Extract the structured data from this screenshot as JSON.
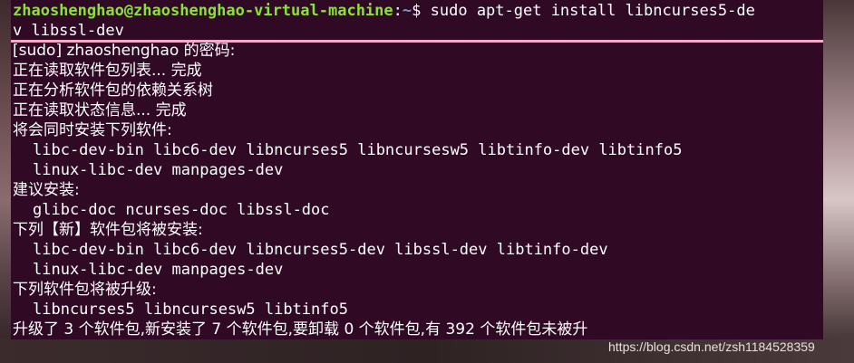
{
  "terminal": {
    "prompt": {
      "user_host": "zhaoshenghao@zhaoshenghao-virtual-machine",
      "separator": ":",
      "path": "~",
      "symbol": "$",
      "command": "sudo apt-get install libncurses5-de"
    },
    "command_continuation": "v libssl-dev",
    "lines": [
      "[sudo] zhaoshenghao 的密码:",
      "正在读取软件包列表... 完成",
      "正在分析软件包的依赖关系树",
      "正在读取状态信息... 完成",
      "将会同时安装下列软件:",
      "libc-dev-bin libc6-dev libncurses5 libncursesw5 libtinfo-dev libtinfo5",
      "linux-libc-dev manpages-dev",
      "建议安装:",
      "glibc-doc ncurses-doc libssl-doc",
      "下列【新】软件包将被安装:",
      "libc-dev-bin libc6-dev libncurses5-dev libssl-dev libtinfo-dev",
      "linux-libc-dev manpages-dev",
      "下列软件包将被升级:",
      "libncurses5 libncursesw5 libtinfo5",
      "升级了 3 个软件包,新安装了 7 个软件包,要卸载 0 个软件包,有 392 个软件包未被升"
    ]
  },
  "watermark": "https://blog.csdn.net/zsh1184528359",
  "colors": {
    "terminal_bg": "#300a24",
    "prompt_user": "#8ae234",
    "prompt_path": "#729fcf",
    "text": "#ffffff",
    "selection_bar": "#f7a8c6"
  }
}
